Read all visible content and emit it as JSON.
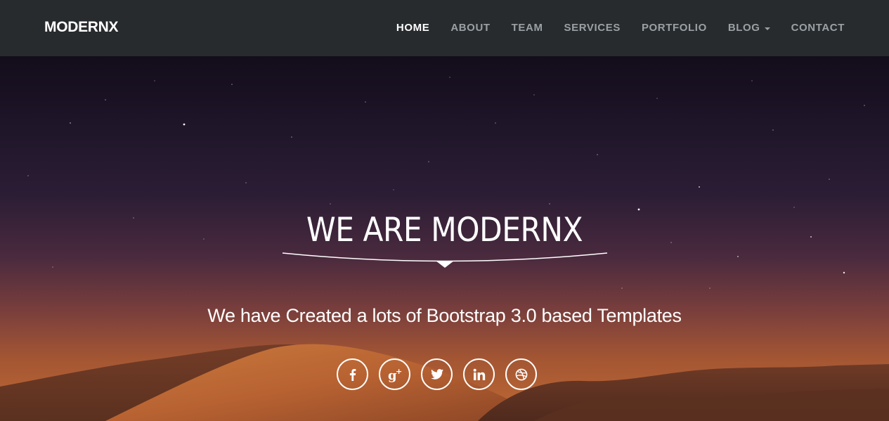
{
  "brand": {
    "name": "MODERNX"
  },
  "nav": {
    "items": [
      {
        "label": "HOME",
        "active": true
      },
      {
        "label": "ABOUT"
      },
      {
        "label": "TEAM"
      },
      {
        "label": "SERVICES"
      },
      {
        "label": "PORTFOLIO"
      },
      {
        "label": "BLOG",
        "has_dropdown": true
      },
      {
        "label": "CONTACT"
      }
    ]
  },
  "hero": {
    "title": "WE ARE MODERNX",
    "subtitle": "We have Created a lots of Bootstrap 3.0 based Templates",
    "social": [
      {
        "name": "facebook",
        "icon": "facebook-icon"
      },
      {
        "name": "google-plus",
        "icon": "google-plus-icon"
      },
      {
        "name": "twitter",
        "icon": "twitter-icon"
      },
      {
        "name": "linkedin",
        "icon": "linkedin-icon"
      },
      {
        "name": "dribbble",
        "icon": "dribbble-icon"
      }
    ]
  },
  "colors": {
    "navbar_bg": "#272b2e",
    "nav_text": "#9aa0a4",
    "nav_active": "#ffffff",
    "hero_text": "#ffffff"
  }
}
